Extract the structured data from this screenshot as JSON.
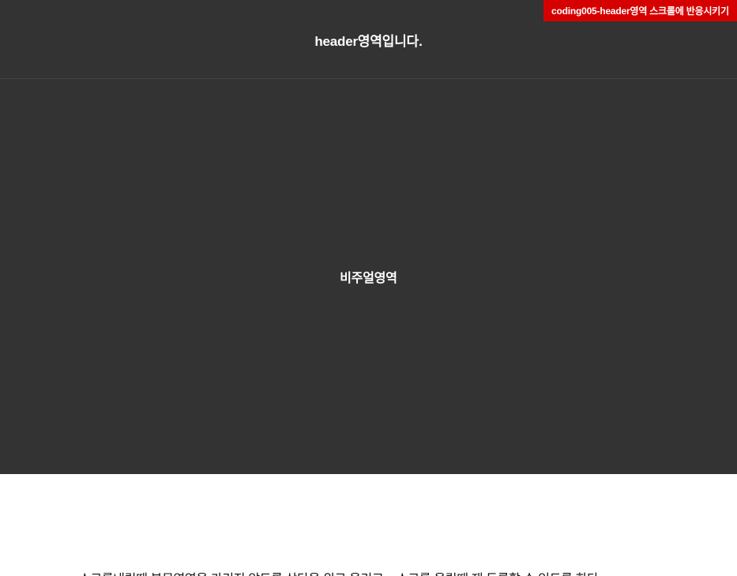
{
  "badge": {
    "label": "coding005-header영역 스크롤에 반응시키기",
    "color": "#d60000"
  },
  "header": {
    "title": "header영역입니다.",
    "background": "#333333"
  },
  "visual": {
    "title": "비주얼영역",
    "background": "#333333"
  },
  "content": {
    "text": "스크롤내릴때 본문영역을 가리지 않도록 상단을 위로 올리고... 스크롤 올릴때 재 등록할 수 있도록 한다."
  }
}
